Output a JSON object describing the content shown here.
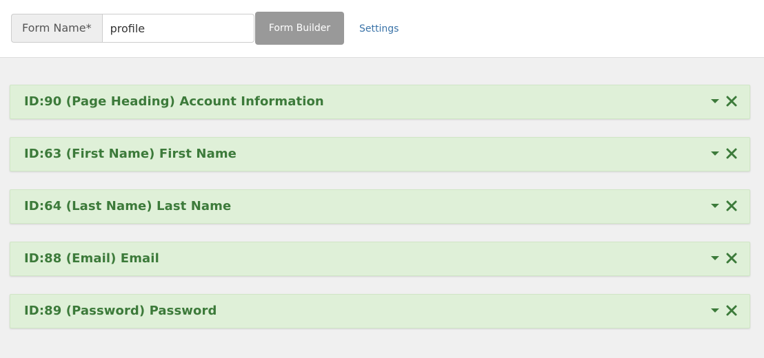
{
  "toolbar": {
    "form_name_label": "Form Name*",
    "form_name_value": "profile",
    "builder_button_label": "Form Builder",
    "settings_link_label": "Settings"
  },
  "fields": [
    {
      "title": "ID:90 (Page Heading) Account Information",
      "expand_icon": "caret-down-icon",
      "remove_icon": "close-icon"
    },
    {
      "title": "ID:63 (First Name) First Name",
      "expand_icon": "caret-down-icon",
      "remove_icon": "close-icon"
    },
    {
      "title": "ID:64 (Last Name) Last Name",
      "expand_icon": "caret-down-icon",
      "remove_icon": "close-icon"
    },
    {
      "title": "ID:88 (Email) Email",
      "expand_icon": "caret-down-icon",
      "remove_icon": "close-icon"
    },
    {
      "title": "ID:89 (Password) Password",
      "expand_icon": "caret-down-icon",
      "remove_icon": "close-icon"
    }
  ],
  "colors": {
    "field_background": "#dff0d8",
    "field_text": "#3c7a3a",
    "builder_button": "#999999",
    "link": "#3a73a8"
  }
}
